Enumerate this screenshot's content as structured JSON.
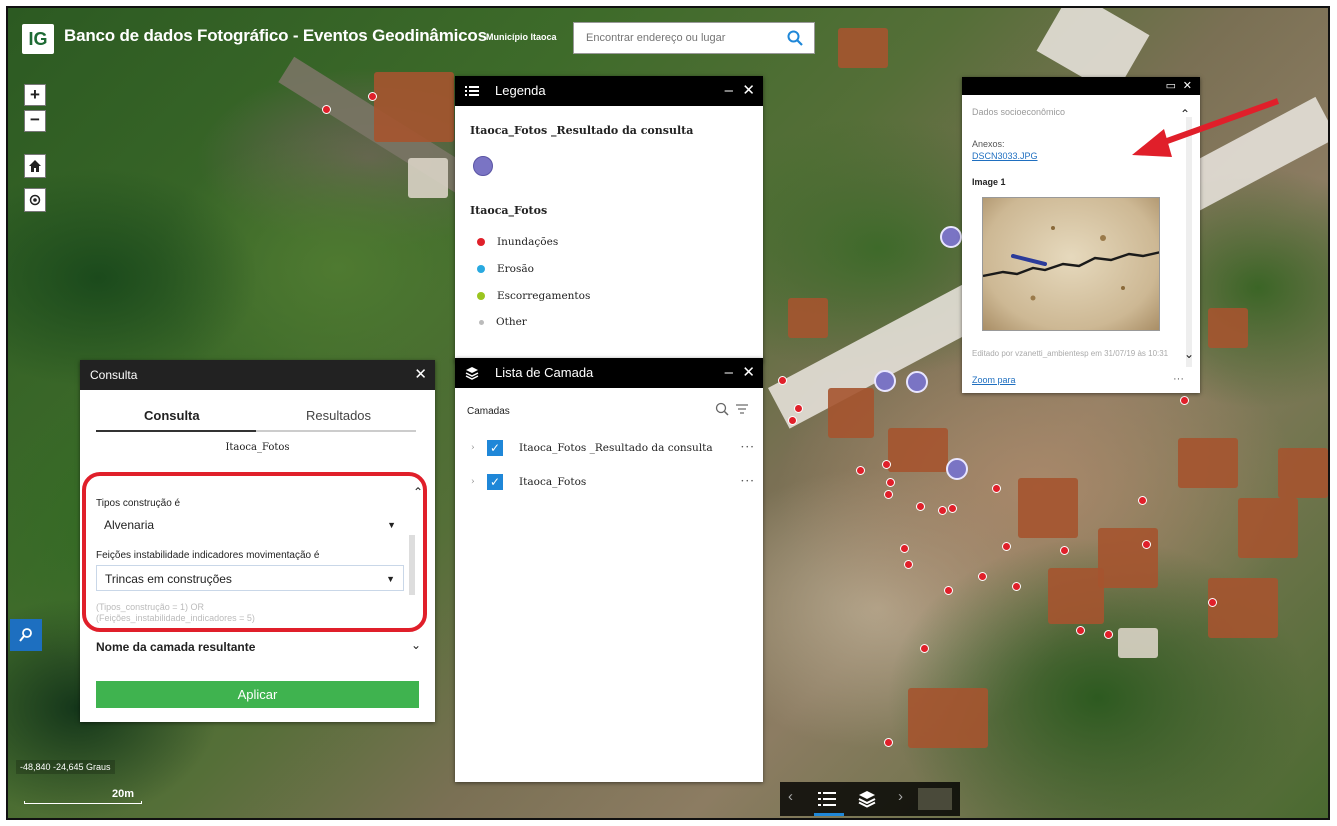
{
  "header": {
    "logo_text": "IG",
    "title": "Banco de dados Fotográfico - Eventos Geodinâmicos",
    "municipality": "Município Itaoca",
    "search_placeholder": "Encontrar endereço ou lugar"
  },
  "map_controls": {
    "zoom_in": "+",
    "zoom_out": "−",
    "coordinates": "-48,840 -24,645 Graus",
    "scale_label": "20m"
  },
  "legend": {
    "title": "Legenda",
    "layer1": "Itaoca_Fotos _Resultado da consulta",
    "layer2": "Itaoca_Fotos",
    "items": [
      {
        "label": "Inundações",
        "color": "#e0202a"
      },
      {
        "label": "Erosão",
        "color": "#29a9e0"
      },
      {
        "label": "Escorregamentos",
        "color": "#9bc520"
      },
      {
        "label": "Other",
        "color": "#bbbbbb"
      }
    ]
  },
  "layer_list": {
    "title": "Lista de Camada",
    "label": "Camadas",
    "layers": [
      {
        "name": "Itaoca_Fotos _Resultado da consulta"
      },
      {
        "name": "Itaoca_Fotos"
      }
    ]
  },
  "query": {
    "title": "Consulta",
    "tab_query": "Consulta",
    "tab_results": "Resultados",
    "layer_name": "Itaoca_Fotos",
    "field1_label": "Tipos construção é",
    "field1_value": "Alvenaria",
    "field2_label": "Feições instabilidade indicadores movimentação é",
    "field2_value": "Trincas em construções",
    "expression": "(Tipos_construção = 1) OR\n(Feições_instabilidade_indicadores = 5)",
    "result_layer_label": "Nome da camada resultante",
    "apply_label": "Aplicar"
  },
  "popup": {
    "top_text": "Dados socioeconômico",
    "attachments_label": "Anexos:",
    "attachment_link": "DSCN3033.JPG",
    "image_label": "Image 1",
    "edited_text": "Editado por vzanetti_ambientesp em 31/07/19 às 10:31",
    "zoom_link": "Zoom para",
    "more": "···"
  },
  "colors": {
    "accent_blue": "#1f87d8",
    "apply_green": "#3fb34f",
    "highlight_red": "#e01f2a",
    "query_point": "#7a74c4"
  }
}
